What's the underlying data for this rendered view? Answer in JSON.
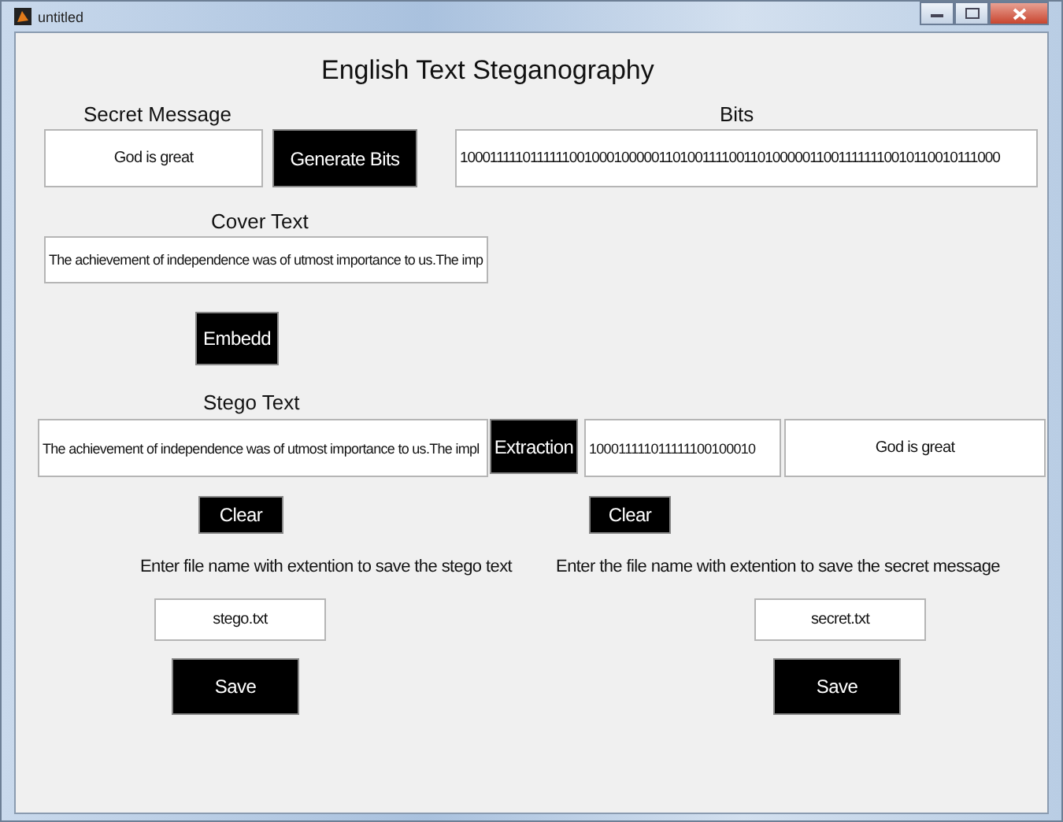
{
  "window": {
    "title": "untitled"
  },
  "heading": "English Text Steganography",
  "secret_message": {
    "label": "Secret Message",
    "value": "God is great"
  },
  "generate_button": "Generate Bits",
  "bits": {
    "label": "Bits",
    "value": "1000111110111111001000100000110100111100110100000110011111110010110010111000"
  },
  "cover_text": {
    "label": "Cover Text",
    "value": "The achievement of independence was of utmost importance to us.The imp"
  },
  "embed_button": "Embedd",
  "stego_text": {
    "label": "Stego Text",
    "value": "The achievement of independence was of utmost importance to us.The impl"
  },
  "extraction_button": "Extraction",
  "extracted_bits": {
    "value": "100011111011111100100010"
  },
  "extracted_message": {
    "value": "God is great"
  },
  "clear_buttons": [
    "Clear",
    "Clear"
  ],
  "save_sections": [
    {
      "label": "Enter file name with extention to save the stego text",
      "value": "stego.txt",
      "button": "Save"
    },
    {
      "label": "Enter the file name with extention to save the secret message",
      "value": "secret.txt",
      "button": "Save"
    }
  ]
}
